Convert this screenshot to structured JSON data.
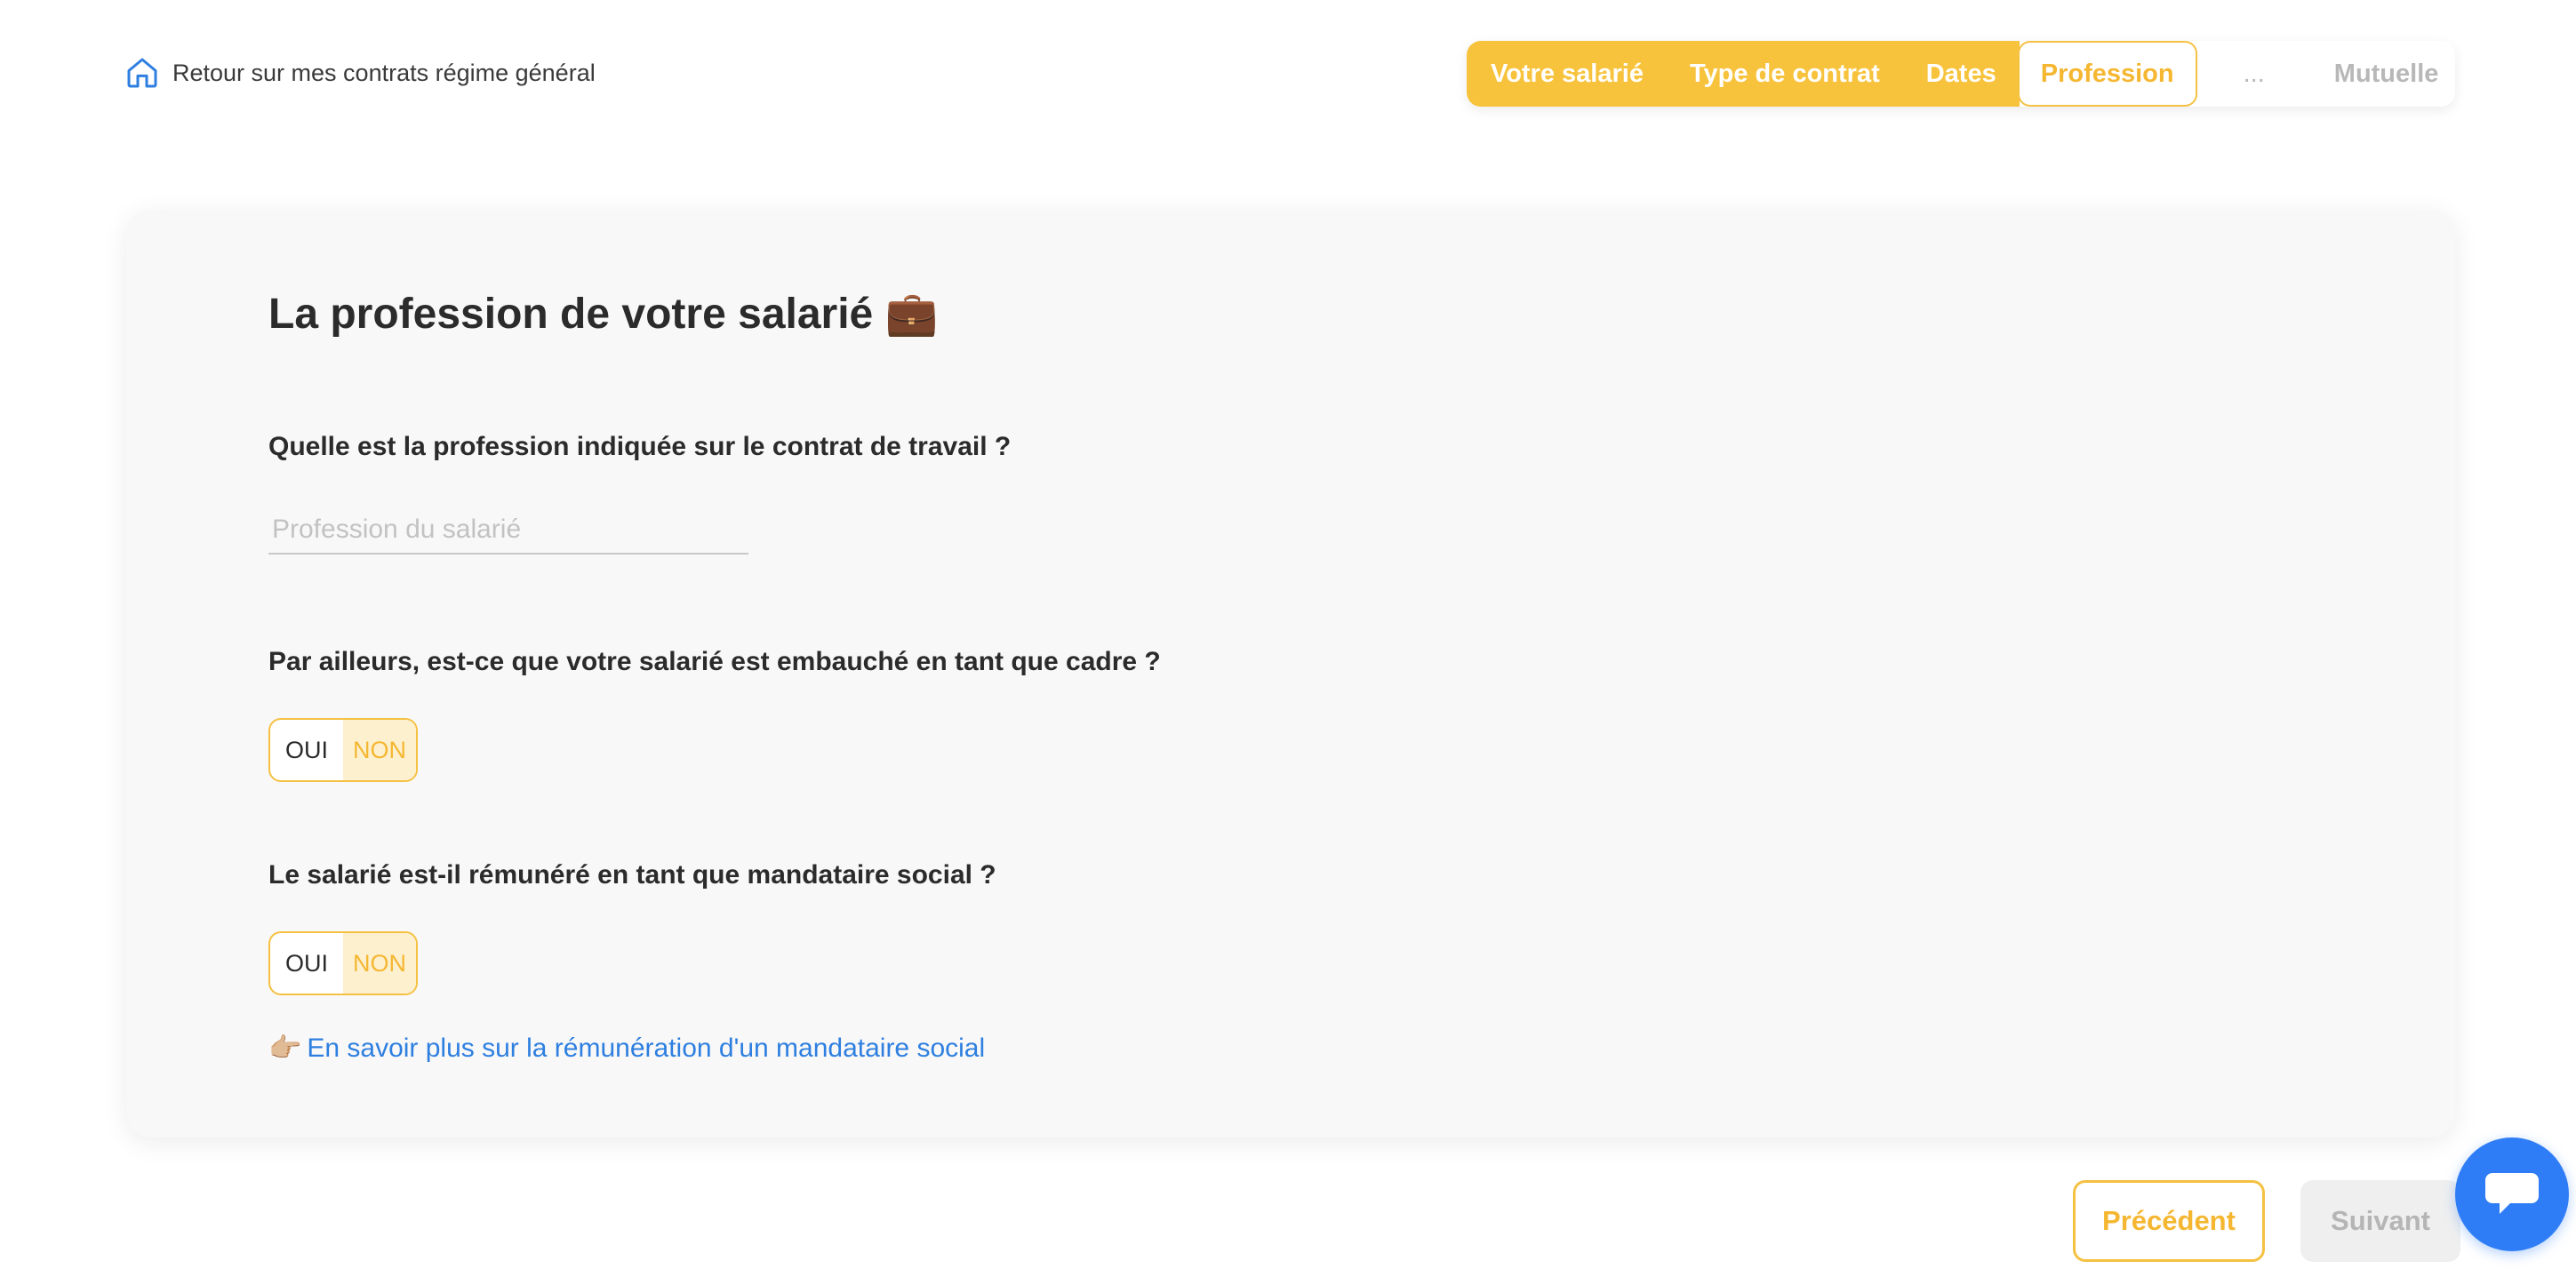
{
  "header": {
    "back_label": "Retour sur mes contrats régime général"
  },
  "stepper": {
    "steps": [
      {
        "label": "Votre salarié",
        "state": "done"
      },
      {
        "label": "Type de contrat",
        "state": "done"
      },
      {
        "label": "Dates",
        "state": "done"
      },
      {
        "label": "Profession",
        "state": "current"
      },
      {
        "label": "...",
        "state": "future"
      },
      {
        "label": "Mutuelle",
        "state": "future"
      }
    ]
  },
  "card": {
    "title": "La profession de votre salarié",
    "title_emoji": "💼",
    "q1": {
      "label": "Quelle est la profession indiquée sur le contrat de travail ?",
      "placeholder": "Profession du salarié",
      "value": ""
    },
    "q2": {
      "label": "Par ailleurs, est-ce que votre salarié est embauché en tant que cadre ?",
      "options": [
        "OUI",
        "NON"
      ],
      "selected": "NON"
    },
    "q3": {
      "label": "Le salarié est-il rémunéré en tant que mandataire social ?",
      "options": [
        "OUI",
        "NON"
      ],
      "selected": "NON"
    },
    "info_link": {
      "emoji": "👉🏼",
      "label": "En savoir plus sur la rémunération d'un mandataire social"
    }
  },
  "footer": {
    "prev_label": "Précédent",
    "next_label": "Suivant"
  },
  "colors": {
    "accent": "#f8c33c",
    "link": "#2e7fe0",
    "chat": "#2f7df6"
  },
  "icons": {
    "back": "home-icon",
    "chat": "chat-bubble-icon"
  }
}
